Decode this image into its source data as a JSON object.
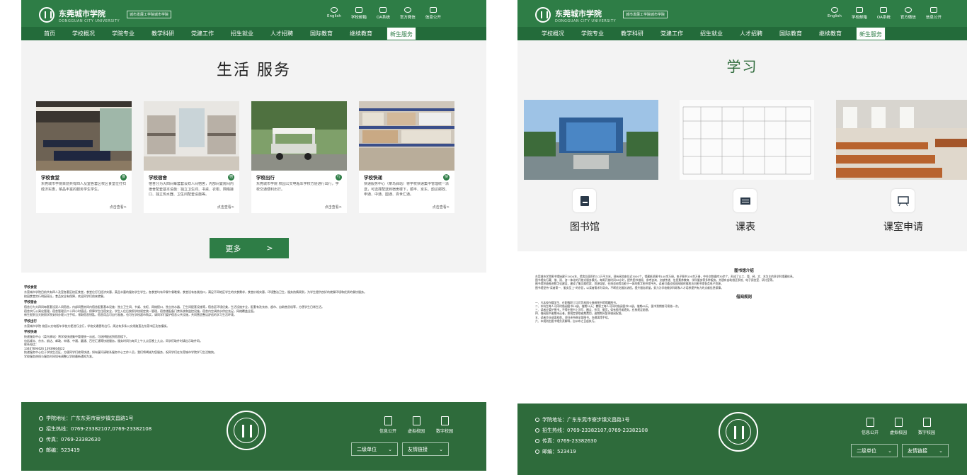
{
  "header": {
    "school_name": "东莞城市学院",
    "school_name_en": "DONGGUAN CITY UNIVERSITY",
    "tagline": "城市发展工学院城市学院",
    "utility_links": [
      "English",
      "学校邮箱",
      "OA系统",
      "官方微信",
      "信息公开"
    ]
  },
  "left": {
    "nav": [
      "首页",
      "学校概况",
      "学院专业",
      "教学科研",
      "党建工作",
      "招生就业",
      "人才招聘",
      "国际教育",
      "继续教育",
      "新生服务"
    ],
    "active_nav": "新生服务",
    "hero_title": "生活 服务",
    "cards": [
      {
        "title": "学校食堂",
        "badge": "食",
        "desc": "东莞城市学院目前共有四人及室各套区校区食堂位打扫经济实惠，菜品丰富的服务学生学生。",
        "more": "点击查看>"
      },
      {
        "title": "学校宿舍",
        "badge": "宿",
        "desc": "宿舍分为大四间每套套设双人间宿舍，内部间置房间内宿舍配套基本设施：独立卫生间、书桌、衣柜、网络接口、独立热水器、卫生间配套设施等。",
        "more": "点击查看>"
      },
      {
        "title": "学校出行",
        "badge": "行",
        "desc": "东莞城市学院 校园公交电瓶车学校方便进行出行，学校交通便利出行。",
        "more": "点击查看>"
      },
      {
        "title": "学校快递",
        "badge": "快",
        "desc": "快递服务中心（菜鸟驿站）将学校快递集中管理统一派送，可选择配送到宿舍楼下，顺丰、京东、韵达邮政、申通、中通、圆通、百世汇通。",
        "more": "点击查看>"
      }
    ],
    "more_button": "更多",
    "more_arrow": ">",
    "article_sections": [
      {
        "title": "学校食堂",
        "lines": [
          "东莞城市学院目前共有四人及室各套区校区食堂，食堂位打扫经济实惠，菜品丰富的服务学生学生。各食堂均有早餐午餐晚餐，食堂设有各类档口，满足不同地区学生的饮食需求，食堂价格实惠，环境整洁卫生，服务热情周到，为学生提供良好的就餐环境和优质的餐饮服务。",
          "校园食堂实行明厨亮灶，食品安全有保障，欢迎同学们前来就餐。"
        ]
      },
      {
        "title": "学校宿舍",
        "lines": [
          "宿舍分为大四间每套套设双人间宿舍，内部间置房间内宿舍配套基本设施：独立卫生间、书桌、衣柜、网络接口、独立热水器、卫生间配套设施等，宿舍区环境优美，生活设施齐全，配套有洗衣房、超市、自助售货机等，方便学生日常生活。",
          "宿舍实行公寓化管理，宿舍管理员二十四小时值班，保障学生住宿安全，学生入住后按照学校规定统一管理，宿舍楼配备门禁系统和监控设施，宿舍内空调热水供应充足，网络覆盖全面。",
          "新生报到当天按照学院安排办理入住手续，领取宿舍钥匙，宿舍用品可自行准备，也可在学校超市购买，请同学们爱护宿舍公共设施，共同营造整洁舒适的学习生活环境。"
        ]
      },
      {
        "title": "学校出行",
        "lines": [
          "东莞城市学院 校园公交电瓶车学校方便进行出行，学校交通便利出行，周边有多条公交线路直达东莞市区及各镇街。"
        ]
      },
      {
        "title": "学校快递",
        "lines": [
          "快递服务中心（菜鸟驿站）将学校快递集中管理统一派送，可选择配送到宿舍楼下。",
          "包括顺丰、京东、韵达、邮政、申通、中通、圆通、百世汇通等快递服务，服务时间为每天上午九点至晚上九点，同学们取件时请出示取件码。",
          "联系电话：",
          "13407694626 13939804622",
          "快递服务中心位于学校生活区，方便同学们收寄快递，如有疑问请联系服务中心工作人员，我们将竭诚为您服务，祝同学们在东莞城市学院学习生活愉快。",
          "学校服务热线与服务时间如有调整以学校最新通知为准。"
        ]
      }
    ]
  },
  "right": {
    "nav": [
      "学校概况",
      "学院专业",
      "教学科研",
      "党建工作",
      "招生就业",
      "人才招聘",
      "国际教育",
      "继续教育",
      "新生服务"
    ],
    "active_nav": "新生服务",
    "hero_title": "学习",
    "items": [
      {
        "label": "图书馆",
        "icon": "library-icon"
      },
      {
        "label": "课表",
        "icon": "schedule-icon"
      },
      {
        "label": "课室申请",
        "icon": "classroom-icon"
      }
    ],
    "article_title": "图书馆介绍",
    "article_lines": [
      "东莞城市学院图书馆始建于2004年，馆舍总面积约3.2万平方米，现有阅览座位近3000个，馆藏纸质图书140余万册，电子图书100余万册，中外文数据库30余个，形成了以工、管、经、文、艺为主的多学科馆藏体系。",
      "图书馆实行藏、借、阅、咨一体化的开放式服务模式，每周开放时间98小时，提供图书借阅、参考咨询、文献传递、信息素养教育、学科服务等多种服务，并建有自助借还系统、电子阅览室、研讨室等。",
      "图书馆积极推进数字化建设，建成了集文献检索、资源导航、在线咨询等功能于一体的数字图书馆平台，读者可通过校园网随时随地访问图书馆各类电子资源。",
      "图书馆坚持“读者第一、服务至上”的宗旨，以读者需求为导向，不断优化服务流程，提升服务质量，努力为学校教学科研和人才培养提供有力的文献信息保障。"
    ],
    "rules_title": "借阅规则",
    "rules_lines": [
      "一、凡本校在籍学生、在职教职工均可凭校园卡借阅图书馆馆藏图书。",
      "二、本科生每人可同时借阅图书10册，借期30天；教职工每人可同时借阅图书20册，借期60天，图书到期前可续借一次。",
      "三、读者应爱护图书，不得在图书上涂写、圈点、折页、撕页，如有损坏或遗失，应按规定赔偿。",
      "四、借阅图书逾期未还者，按规定收取逾期费用，逾期期间暂停借阅权限。",
      "五、读者毕业或离校前，须归还所借全部图书，办理离馆手续。",
      "六、本规则由图书馆负责解释，自公布之日起执行。"
    ]
  },
  "footer": {
    "address": "学院地址：广东东莞市寮步镇文昌路1号",
    "hotline": "招生热线：0769-23382107,0769-23382108",
    "fax": "传真：0769-23382630",
    "postcode": "邮编：523419",
    "links": [
      "信息公开",
      "虚拟校园",
      "数字校园"
    ],
    "select_secondary": "二级单位",
    "select_friend": "友情链接"
  },
  "colors": {
    "primary": "#2e7d46",
    "nav_dark": "#236b3a",
    "footer": "#2e6b3b",
    "hero_bg": "#f3f3f3"
  }
}
